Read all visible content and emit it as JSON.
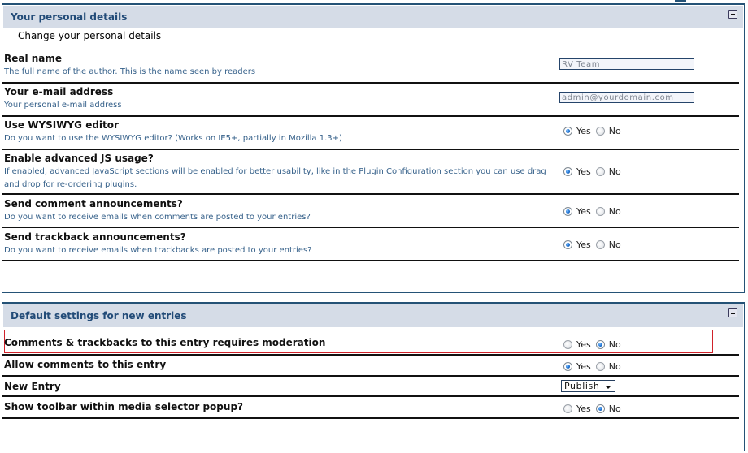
{
  "sections": [
    {
      "title": "Your personal details",
      "subtitle": "Change your personal details",
      "collapse_icon": "minus-box-icon",
      "rows": [
        {
          "label": "Real name",
          "description": "The full name of the author. This is the name seen by readers",
          "type": "text",
          "value": "RV Team"
        },
        {
          "label": "Your e-mail address",
          "description": "Your personal e-mail address",
          "type": "text",
          "value": "admin@yourdomain.com"
        },
        {
          "label": "Use WYSIWYG editor",
          "description": "Do you want to use the WYSIWYG editor? (Works on IE5+, partially in Mozilla 1.3+)",
          "type": "radio",
          "selected": "Yes"
        },
        {
          "label": "Enable advanced JS usage?",
          "description": "If enabled, advanced JavaScript sections will be enabled for better usability, like in the Plugin Configuration section you can use drag and drop for re-ordering plugins.",
          "type": "radio",
          "selected": "Yes"
        },
        {
          "label": "Send comment announcements?",
          "description": "Do you want to receive emails when comments are posted to your entries?",
          "type": "radio",
          "selected": "Yes"
        },
        {
          "label": "Send trackback announcements?",
          "description": "Do you want to receive emails when trackbacks are posted to your entries?",
          "type": "radio",
          "selected": "Yes"
        }
      ]
    },
    {
      "title": "Default settings for new entries",
      "collapse_icon": "minus-box-icon",
      "rows": [
        {
          "label": "Comments & trackbacks to this entry requires moderation",
          "type": "radio",
          "selected": "No",
          "highlighted": true
        },
        {
          "label": "Allow comments to this entry",
          "type": "radio",
          "selected": "Yes"
        },
        {
          "label": "New Entry",
          "type": "select",
          "value": "Publish"
        },
        {
          "label": "Show toolbar within media selector popup?",
          "type": "radio",
          "selected": "No"
        }
      ]
    }
  ],
  "radio_options": {
    "yes": "Yes",
    "no": "No"
  },
  "colors": {
    "header_bg": "#d5dce7",
    "title": "#224b78",
    "description": "#36618a",
    "border": "#245276",
    "highlight": "#d0222a"
  }
}
